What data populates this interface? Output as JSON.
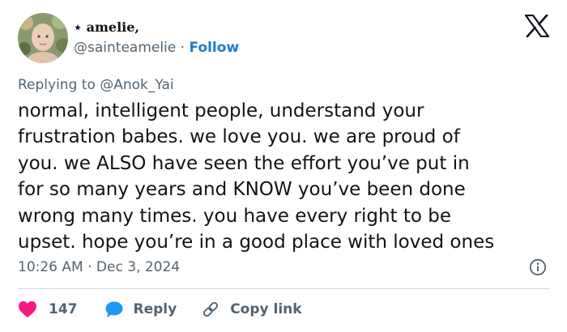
{
  "author": {
    "display_name": "⋆ amelie,",
    "handle": "@sainteamelie",
    "separator": "·",
    "follow_label": "Follow"
  },
  "reply_context": {
    "text": "Replying to @Anok_Yai"
  },
  "body": {
    "lines": [
      "normal, intelligent people, understand your",
      "frustration babes. we love you. we are proud of",
      "you. we ALSO have seen the effort you’ve put in",
      "for so many years and KNOW you’ve been done",
      "wrong many times. you have every right to be",
      "upset. hope you’re in a good place with loved ones"
    ]
  },
  "meta": {
    "time": "10:26 AM",
    "separator": "·",
    "date": "Dec 3, 2024"
  },
  "actions": {
    "like_count": "147",
    "reply_label": "Reply",
    "copy_label": "Copy link"
  },
  "icons": {
    "brand": "x-logo-icon",
    "info": "info-icon",
    "like": "heart-icon",
    "reply": "speech-bubble-icon",
    "copy": "link-icon"
  },
  "colors": {
    "text": "#0f1419",
    "secondary": "#536471",
    "follow": "#1d7dc9",
    "like": "#f91880",
    "reply": "#1d9bf0",
    "divider": "#cfd9de"
  }
}
